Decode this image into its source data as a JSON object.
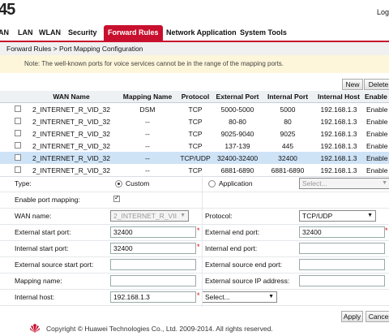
{
  "header": {
    "brand": "45",
    "logout": "Log"
  },
  "nav": {
    "items": [
      {
        "label": "AN"
      },
      {
        "label": "LAN"
      },
      {
        "label": "WLAN"
      },
      {
        "label": "Security"
      },
      {
        "label": "Forward Rules",
        "active": true
      },
      {
        "label": "Network Application"
      },
      {
        "label": "System Tools"
      }
    ]
  },
  "breadcrumb": "Forward Rules > Port Mapping Configuration",
  "note": "Note: The well-known ports for voice services cannot be in the range of the mapping ports.",
  "actions": {
    "new": "New",
    "delete": "Delete"
  },
  "table": {
    "columns": [
      "WAN Name",
      "Mapping Name",
      "Protocol",
      "External Port",
      "Internal Port",
      "Internal Host",
      "Enable"
    ],
    "rows": [
      {
        "wan": "2_INTERNET_R_VID_32",
        "name": "DSM",
        "protocol": "TCP",
        "ext": "5000-5000",
        "int": "5000",
        "host": "192.168.1.3",
        "enable": "Enable"
      },
      {
        "wan": "2_INTERNET_R_VID_32",
        "name": "--",
        "protocol": "TCP",
        "ext": "80-80",
        "int": "80",
        "host": "192.168.1.3",
        "enable": "Enable"
      },
      {
        "wan": "2_INTERNET_R_VID_32",
        "name": "--",
        "protocol": "TCP",
        "ext": "9025-9040",
        "int": "9025",
        "host": "192.168.1.3",
        "enable": "Enable"
      },
      {
        "wan": "2_INTERNET_R_VID_32",
        "name": "--",
        "protocol": "TCP",
        "ext": "137-139",
        "int": "445",
        "host": "192.168.1.3",
        "enable": "Enable"
      },
      {
        "wan": "2_INTERNET_R_VID_32",
        "name": "--",
        "protocol": "TCP/UDP",
        "ext": "32400-32400",
        "int": "32400",
        "host": "192.168.1.3",
        "enable": "Enable",
        "selected": true
      },
      {
        "wan": "2_INTERNET_R_VID_32",
        "name": "--",
        "protocol": "TCP",
        "ext": "6881-6890",
        "int": "6881-6890",
        "host": "192.168.1.3",
        "enable": "Enable"
      }
    ]
  },
  "form": {
    "type_label": "Type:",
    "type_custom": "Custom",
    "type_application": "Application",
    "application_select": "Select...",
    "enable_label": "Enable port mapping:",
    "wan_label": "WAN name:",
    "wan_value": "2_INTERNET_R_VII",
    "protocol_label": "Protocol:",
    "protocol_value": "TCP/UDP",
    "ext_start_label": "External start port:",
    "ext_start_value": "32400",
    "ext_end_label": "External end port:",
    "ext_end_value": "32400",
    "int_start_label": "Internal start port:",
    "int_start_value": "32400",
    "int_end_label": "Internal end port:",
    "int_end_value": "",
    "src_start_label": "External source start port:",
    "src_start_value": "",
    "src_end_label": "External source end port:",
    "src_end_value": "",
    "mapping_name_label": "Mapping name:",
    "mapping_name_value": "",
    "src_ip_label": "External source IP address:",
    "src_ip_value": "",
    "host_label": "Internal host:",
    "host_value": "192.168.1.3",
    "host_select": "Select...",
    "required_mark": "*"
  },
  "buttons": {
    "apply": "Apply",
    "cancel": "Cancel"
  },
  "footer": {
    "copyright": "Copyright © Huawei Technologies Co., Ltd. 2009-2014. All rights reserved."
  },
  "colors": {
    "accent": "#c8102e",
    "selected_row": "#cfe3f6",
    "note_bg": "#fdf6da"
  }
}
